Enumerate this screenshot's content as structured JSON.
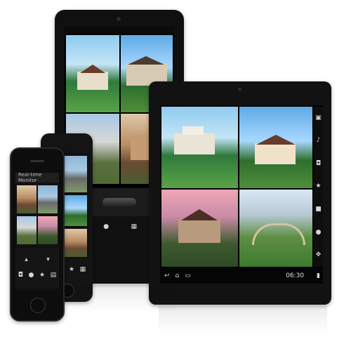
{
  "phone_app": {
    "title": "Real-time Monitor"
  },
  "tablet": {
    "status_time": "06:30"
  },
  "icons": {
    "camera": "camera-icon",
    "mic": "mic-icon",
    "star": "star-icon",
    "stop": "stop-icon",
    "back": "back-icon",
    "home": "home-icon",
    "recent": "recent-apps-icon",
    "grid": "grid-icon"
  },
  "colors": {
    "device": "#101010",
    "screen": "#000000",
    "accent": "#2f7a3b"
  }
}
